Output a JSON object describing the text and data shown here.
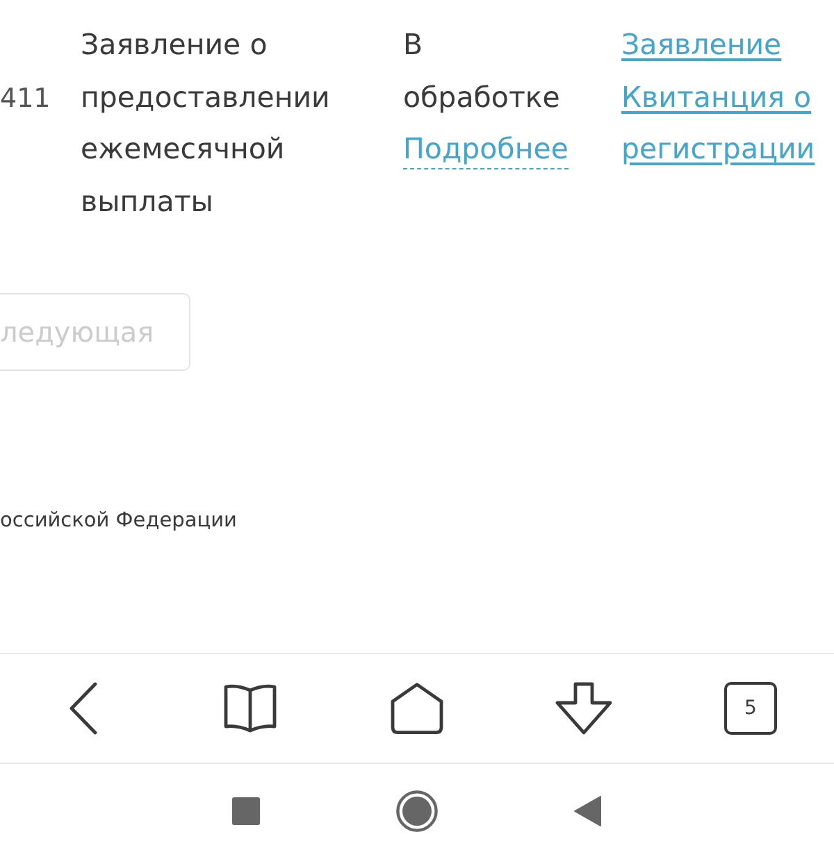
{
  "table": {
    "rows": [
      {
        "column_1": "411",
        "application": "Заявление о предоставлении ежемесячной выплаты",
        "status": "В обработке",
        "details_link": "Подробнее",
        "documents": [
          "Заявление",
          "Квитанция о регистрации"
        ]
      }
    ]
  },
  "pagination": {
    "next_button": {
      "label": "ледующая",
      "disabled": true
    }
  },
  "footer": {
    "text": "оссийской Федерации"
  },
  "browser_toolbar": {
    "tab_count": "5"
  }
}
